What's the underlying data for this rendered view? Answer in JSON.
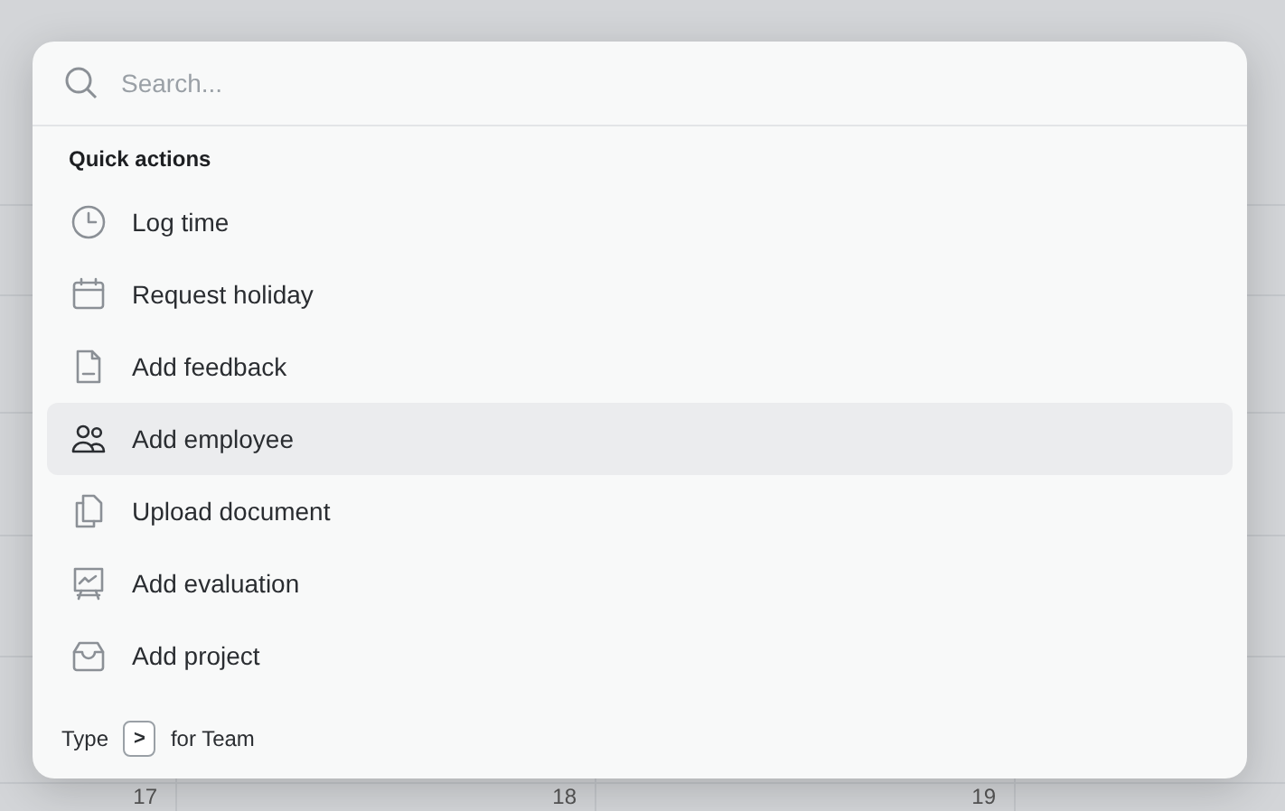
{
  "search": {
    "placeholder": "Search..."
  },
  "section_title": "Quick actions",
  "actions": [
    {
      "label": "Log time",
      "selected": false
    },
    {
      "label": "Request holiday",
      "selected": false
    },
    {
      "label": "Add feedback",
      "selected": false
    },
    {
      "label": "Add employee",
      "selected": true
    },
    {
      "label": "Upload document",
      "selected": false
    },
    {
      "label": "Add evaluation",
      "selected": false
    },
    {
      "label": "Add project",
      "selected": false
    }
  ],
  "footer": {
    "before": "Type",
    "key": ">",
    "after": "for Team"
  },
  "calendar": {
    "days": [
      "17",
      "18",
      "19"
    ]
  }
}
